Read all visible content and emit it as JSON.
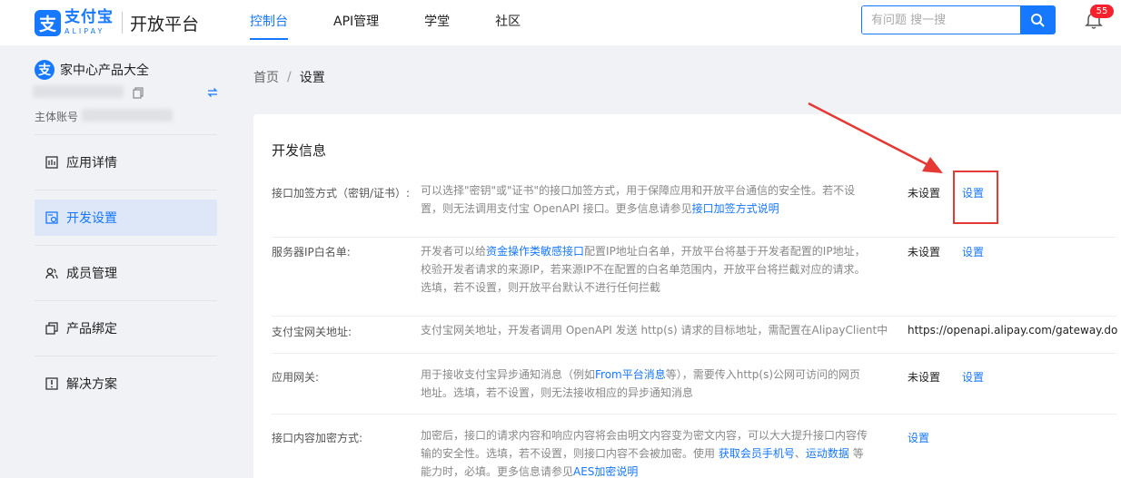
{
  "header": {
    "logo_cn": "支付宝",
    "logo_en": "ALIPAY",
    "logo_glyph": "支",
    "platform": "开放平台",
    "nav": [
      {
        "label": "控制台",
        "active": true
      },
      {
        "label": "API管理"
      },
      {
        "label": "学堂"
      },
      {
        "label": "社区"
      }
    ],
    "search_placeholder": "有问题 搜一搜",
    "notification_count": "55",
    "accent": "#1677ff"
  },
  "sidebar": {
    "app_glyph": "支",
    "app_name": "家中心产品大全",
    "owner_label": "主体账号",
    "items": [
      {
        "label": "应用详情",
        "icon": "app-detail-icon"
      },
      {
        "label": "开发设置",
        "icon": "dev-settings-icon",
        "active": true
      },
      {
        "label": "成员管理",
        "icon": "members-icon"
      },
      {
        "label": "产品绑定",
        "icon": "product-bind-icon"
      },
      {
        "label": "解决方案",
        "icon": "solution-icon"
      }
    ]
  },
  "breadcrumb": {
    "home": "首页",
    "separator": "/",
    "current": "设置"
  },
  "main": {
    "title": "开发信息",
    "rows": [
      {
        "label": "接口加签方式（密钥/证书）:",
        "desc_1": "可以选择\"密钥\"或\"证书\"的接口加签方式，用于保障应用和开放平台通信的安全性。若不设",
        "desc_2": "置，则无法调用支付宝 OpenAPI 接口。更多信息请参见",
        "desc_link": "接口加签方式说明",
        "status": "未设置",
        "action": "设置"
      },
      {
        "label": "服务器IP白名单:",
        "desc_1a": "开发者可以给",
        "desc_1_link": "资金操作类敏感接口",
        "desc_1b": "配置IP地址白名单，开放平台将基于开发者配置的IP地址，",
        "desc_2": "校验开发者请求的来源IP，若来源IP不在配置的白名单范围内，开放平台将拦截对应的请求。",
        "desc_3": "选填，若不设置，则开放平台默认不进行任何拦截",
        "status": "未设置",
        "action": "设置"
      },
      {
        "label": "支付宝网关地址:",
        "desc_1": "支付宝网关地址，开发者调用 OpenAPI 发送 http(s) 请求的目标地址，需配置在AlipayClient中",
        "value": "https://openapi.alipay.com/gateway.do"
      },
      {
        "label": "应用网关:",
        "desc_1a": "用于接收支付宝异步通知消息（例如",
        "desc_1_link": "From平台消息",
        "desc_1b": "等），需要传入http(s)公网可访问的网页",
        "desc_2": "地址。选填，若不设置，则无法接收相应的异步通知消息",
        "status": "未设置",
        "action": "设置"
      },
      {
        "label": "接口内容加密方式:",
        "desc_1": "加密后，接口的请求内容和响应内容将会由明文内容变为密文内容，可以大大提升接口内容传",
        "desc_2a": "输的安全性。选填，若不设置，则接口内容不会被加密。使用 ",
        "desc_2_link1": "获取会员手机号",
        "desc_2_sep": "、",
        "desc_2_link2": "运动数据",
        "desc_2b": " 等",
        "desc_3a": "能力时，必填。更多信息请参见",
        "desc_3_link": "AES加密说明",
        "action": "设置"
      }
    ]
  },
  "annotation_color": "#e53935"
}
